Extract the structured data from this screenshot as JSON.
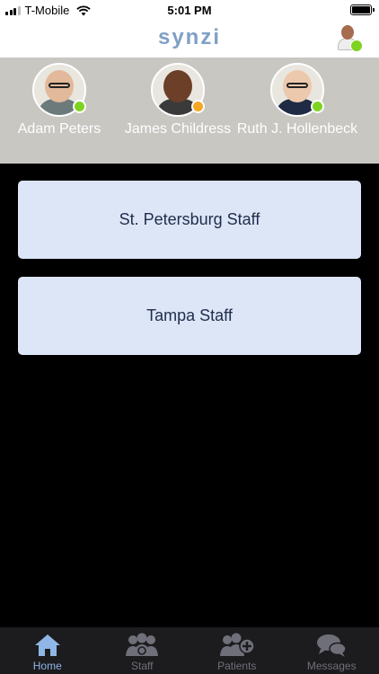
{
  "status_bar": {
    "carrier": "T-Mobile",
    "time": "5:01 PM"
  },
  "header": {
    "logo": "synzi",
    "profile_icon": "doctor-avatar-icon",
    "profile_status_color": "#7ed321"
  },
  "favorites": [
    {
      "name": "Adam Peters",
      "status": "online",
      "status_color": "#7ed321"
    },
    {
      "name": "James Childress",
      "status": "away",
      "status_color": "#f5a623"
    },
    {
      "name": "Ruth J. Hollenbeck",
      "status": "online",
      "status_color": "#7ed321"
    }
  ],
  "groups": [
    {
      "label": "St. Petersburg Staff"
    },
    {
      "label": "Tampa Staff"
    }
  ],
  "tabs": [
    {
      "label": "Home",
      "icon": "home-icon",
      "active": true
    },
    {
      "label": "Staff",
      "icon": "staff-icon",
      "active": false
    },
    {
      "label": "Patients",
      "icon": "patients-icon",
      "active": false
    },
    {
      "label": "Messages",
      "icon": "messages-icon",
      "active": false
    }
  ],
  "colors": {
    "accent": "#8fb6e6",
    "group_button_bg": "#dde6f6",
    "favorites_bg": "#c9c7c2"
  }
}
